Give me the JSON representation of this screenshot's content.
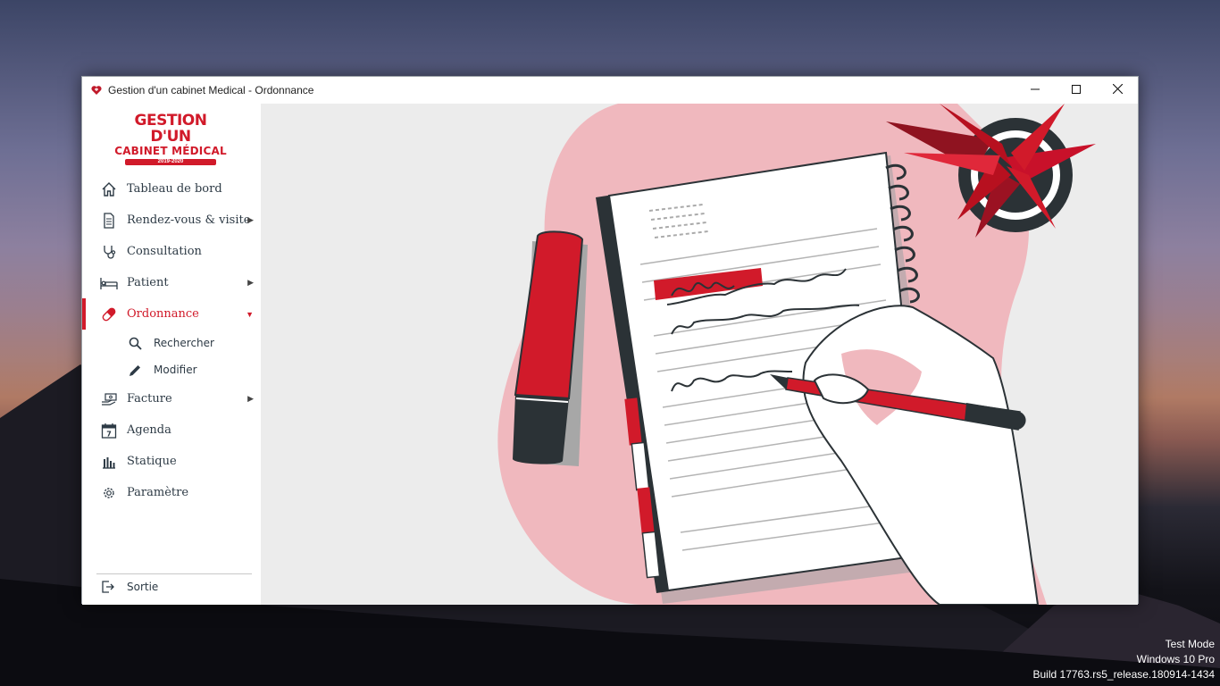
{
  "window": {
    "title": "Gestion d'un cabinet Medical - Ordonnance",
    "controls": {
      "minimize": "minimize-icon",
      "maximize": "maximize-icon",
      "close": "close-icon"
    }
  },
  "logo": {
    "line1": "GESTION D'UN",
    "line2": "CABINET MÉDICAL",
    "year": "2019-2020"
  },
  "sidebar": {
    "items": [
      {
        "label": "Tableau de bord",
        "icon": "home-icon",
        "has_arrow": false
      },
      {
        "label": "Rendez-vous & visite",
        "icon": "document-icon",
        "has_arrow": true
      },
      {
        "label": "Consultation",
        "icon": "stethoscope-icon",
        "has_arrow": false
      },
      {
        "label": "Patient",
        "icon": "bed-icon",
        "has_arrow": true
      },
      {
        "label": "Ordonnance",
        "icon": "pill-icon",
        "has_arrow": true,
        "active": true,
        "expanded": true
      },
      {
        "label": "Facture",
        "icon": "money-hand-icon",
        "has_arrow": true
      },
      {
        "label": "Agenda",
        "icon": "calendar-icon",
        "has_arrow": false
      },
      {
        "label": "Statique",
        "icon": "bar-chart-icon",
        "has_arrow": false
      },
      {
        "label": "Paramètre",
        "icon": "gear-icon",
        "has_arrow": false
      }
    ],
    "subitems": [
      {
        "label": "Rechercher",
        "icon": "search-icon"
      },
      {
        "label": "Modifier",
        "icon": "pencil-icon"
      }
    ],
    "arrow_right": "▶",
    "arrow_down": "▼",
    "exit": {
      "label": "Sortie",
      "icon": "exit-icon"
    }
  },
  "illustration": "notebook-writing-illustration",
  "desktop_watermark": {
    "line1": "Test Mode",
    "line2": "Windows 10 Pro",
    "line3": "Build 17763.rs5_release.180914-1434"
  },
  "colors": {
    "accent": "#d11a2a",
    "pink": "#f0b8be",
    "content_bg": "#ececec",
    "text": "#2d3a45"
  }
}
